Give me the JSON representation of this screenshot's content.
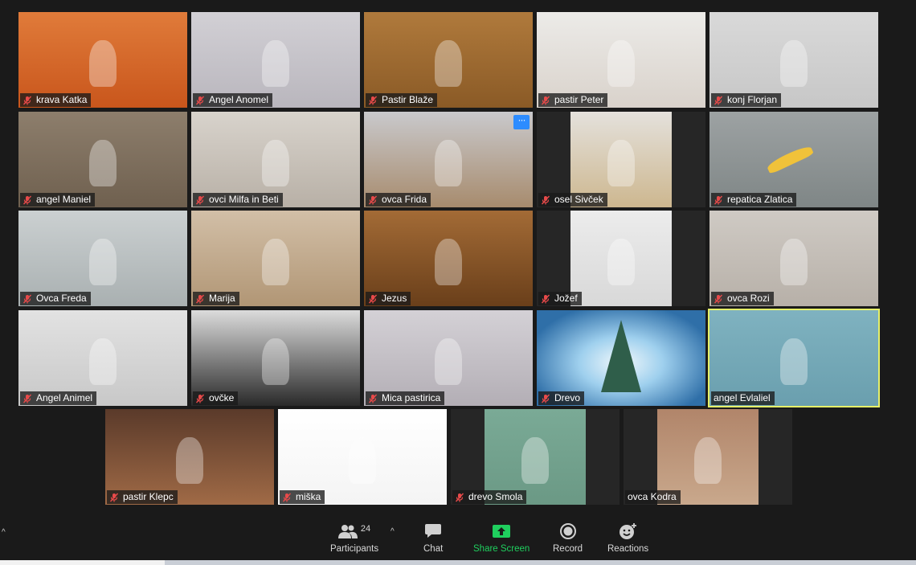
{
  "participants": [
    {
      "name": "krava Katka",
      "muted": true,
      "bg": [
        "#e07b3a",
        "#c9561c"
      ]
    },
    {
      "name": "Angel Anomel",
      "muted": true,
      "bg": [
        "#d2d0d5",
        "#b9b6bd"
      ]
    },
    {
      "name": "Pastir Blaže",
      "muted": true,
      "bg": [
        "#b07a3c",
        "#8a5a26"
      ]
    },
    {
      "name": "pastir Peter",
      "muted": true,
      "bg": [
        "#ecebe8",
        "#d9d2cb"
      ]
    },
    {
      "name": "konj Florjan",
      "muted": true,
      "bg": [
        "#d9d9d9",
        "#c7c7c7"
      ]
    },
    {
      "name": "angel Maniel",
      "muted": true,
      "bg": [
        "#8d7e6c",
        "#6f604f"
      ]
    },
    {
      "name": "ovci Milfa in Beti",
      "muted": true,
      "bg": [
        "#d8d3cc",
        "#b8b0a6"
      ]
    },
    {
      "name": "ovca Frida",
      "muted": true,
      "bg": [
        "#c9c9cc",
        "#a78b6d"
      ]
    },
    {
      "name": "osel Sivček",
      "muted": true,
      "bg": [
        "#e4e1dc",
        "#cdb78f"
      ]
    },
    {
      "name": "repatica Zlatica",
      "muted": true,
      "bg": [
        "#9da2a3",
        "#7f8686"
      ]
    },
    {
      "name": "Ovca Freda",
      "muted": true,
      "bg": [
        "#cbd0d1",
        "#a9b0b1"
      ]
    },
    {
      "name": "Marija",
      "muted": true,
      "bg": [
        "#d2bfa7",
        "#b19675"
      ]
    },
    {
      "name": "Jezus",
      "muted": true,
      "bg": [
        "#a36b36",
        "#6a3f1a"
      ]
    },
    {
      "name": "Jožef",
      "muted": true,
      "bg": [
        "#ececec",
        "#d8d8d8"
      ]
    },
    {
      "name": "ovca Rozi",
      "muted": true,
      "bg": [
        "#cfcac4",
        "#b7b0a8"
      ]
    },
    {
      "name": "Angel Animel",
      "muted": true,
      "bg": [
        "#e2e2e2",
        "#c8c8c8"
      ]
    },
    {
      "name": "ovčke",
      "muted": true,
      "bg": [
        "#dcdcdc",
        "#2a2a2a"
      ]
    },
    {
      "name": "Mica pastirica",
      "muted": true,
      "bg": [
        "#d4d1d6",
        "#b3aeb5"
      ]
    },
    {
      "name": "Drevo",
      "muted": true,
      "bg": [
        "#3f7fb8",
        "#9fd0ee"
      ]
    },
    {
      "name": "angel Evlaliel",
      "muted": false,
      "bg": [
        "#7fb2c0",
        "#6a9fae"
      ]
    },
    {
      "name": "pastir Klepc",
      "muted": true,
      "bg": [
        "#5a3a2a",
        "#a06a46"
      ]
    },
    {
      "name": "miška",
      "muted": true,
      "bg": [
        "#ffffff",
        "#f4f4f4"
      ]
    },
    {
      "name": "drevo Smola",
      "muted": true,
      "bg": [
        "#7aaa96",
        "#6b9985"
      ]
    },
    {
      "name": "ovca Kodra",
      "muted": false,
      "bg": [
        "#b1856a",
        "#c9a88c"
      ]
    }
  ],
  "active_speaker": "angel Evlaliel",
  "accent_color": "#2d8cff",
  "active_color": "#e6f069",
  "toolbar": {
    "participants_label": "Participants",
    "participants_count": "24",
    "chat_label": "Chat",
    "share_label": "Share Screen",
    "record_label": "Record",
    "reactions_label": "Reactions"
  }
}
